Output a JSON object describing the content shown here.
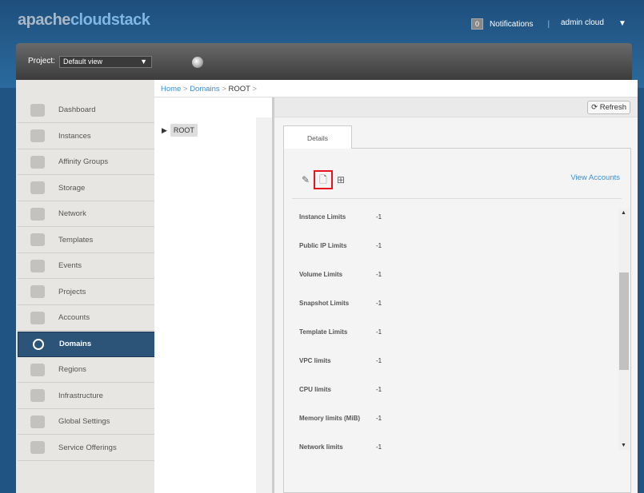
{
  "header": {
    "logo_a": "apache",
    "logo_b": "cloudstack",
    "notifications_count": "0",
    "notifications_label": "Notifications",
    "separator": "|",
    "user": "admin cloud",
    "caret": "▼"
  },
  "projectbar": {
    "label": "Project:",
    "selected": "Default view",
    "caret": "▼"
  },
  "sidebar": {
    "items": [
      {
        "label": "Dashboard"
      },
      {
        "label": "Instances"
      },
      {
        "label": "Affinity Groups"
      },
      {
        "label": "Storage"
      },
      {
        "label": "Network"
      },
      {
        "label": "Templates"
      },
      {
        "label": "Events"
      },
      {
        "label": "Projects"
      },
      {
        "label": "Accounts"
      },
      {
        "label": "Domains"
      },
      {
        "label": "Regions"
      },
      {
        "label": "Infrastructure"
      },
      {
        "label": "Global Settings"
      },
      {
        "label": "Service Offerings"
      }
    ],
    "active": "Domains"
  },
  "breadcrumb": {
    "home": "Home",
    "domains": "Domains",
    "current": "ROOT",
    "sep": ">"
  },
  "tree": {
    "node": "ROOT",
    "arrow": "▶"
  },
  "main": {
    "refresh": "Refresh",
    "tab": "Details",
    "view_accounts": "View Accounts",
    "limits": [
      {
        "label": "Instance Limits",
        "value": "-1"
      },
      {
        "label": "Public IP Limits",
        "value": "-1"
      },
      {
        "label": "Volume Limits",
        "value": "-1"
      },
      {
        "label": "Snapshot Limits",
        "value": "-1"
      },
      {
        "label": "Template Limits",
        "value": "-1"
      },
      {
        "label": "VPC limits",
        "value": "-1"
      },
      {
        "label": "CPU limits",
        "value": "-1"
      },
      {
        "label": "Memory limits (MiB)",
        "value": "-1"
      },
      {
        "label": "Network limits",
        "value": "-1"
      }
    ]
  },
  "colors": {
    "highlight": "#e5141b",
    "accent": "#3a8fd4",
    "active_nav": "#2c5478"
  }
}
